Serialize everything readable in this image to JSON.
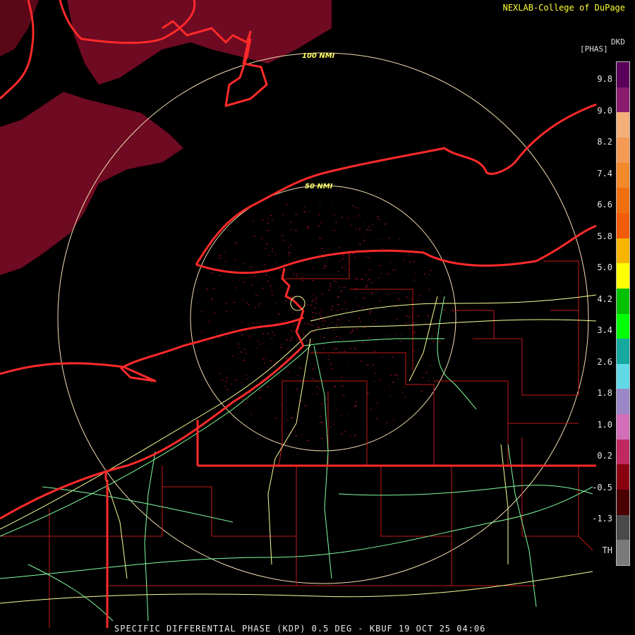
{
  "header": {
    "credit": "NEXLAB-College of DuPage"
  },
  "legend": {
    "product_code": "DKD",
    "units": "[PHAS]",
    "ticks": [
      "9.8",
      "9.0",
      "8.2",
      "7.4",
      "6.6",
      "5.8",
      "5.0",
      "4.2",
      "3.4",
      "2.6",
      "1.8",
      "1.0",
      "0.2",
      "-0.5",
      "-1.3",
      "TH"
    ],
    "colors": [
      "#5a005a",
      "#8a1b6e",
      "#f5b07a",
      "#f49a55",
      "#f28a2b",
      "#f07010",
      "#f35c07",
      "#f7b500",
      "#ffff00",
      "#00c000",
      "#00ff00",
      "#17a8a0",
      "#61d9e7",
      "#9b87c8",
      "#d36fb8",
      "#c02860",
      "#8a0010",
      "#4a0000",
      "#4a4a4a",
      "#7a7a7a"
    ]
  },
  "rings": [
    {
      "label": "100 NMI",
      "color": "#f5deb3"
    },
    {
      "label": "50 NMI",
      "color": "#f5deb3"
    }
  ],
  "footer": {
    "caption": "SPECIFIC DIFFERENTIAL PHASE (KDP) 0.5 DEG - KBUF 19 OCT 25 04:06"
  }
}
